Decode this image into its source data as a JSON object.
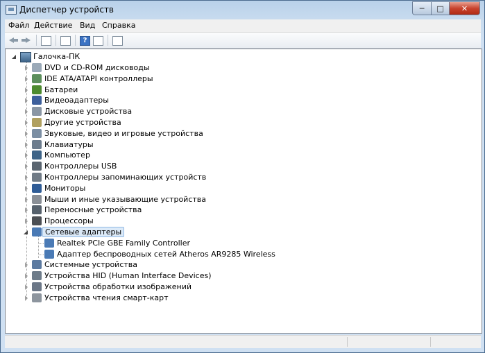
{
  "window": {
    "title": "Диспетчер устройств"
  },
  "menu": [
    {
      "label": "Файл"
    },
    {
      "label": "Действие"
    },
    {
      "label": "Вид"
    },
    {
      "label": "Справка"
    }
  ],
  "tree": {
    "root": "Галочка-ПК",
    "categories": [
      {
        "label": "DVD и CD-ROM дисководы",
        "icon": "dvd-drive-icon"
      },
      {
        "label": "IDE ATA/ATAPI контроллеры",
        "icon": "ide-controller-icon"
      },
      {
        "label": "Батареи",
        "icon": "battery-icon"
      },
      {
        "label": "Видеоадаптеры",
        "icon": "display-adapter-icon"
      },
      {
        "label": "Дисковые устройства",
        "icon": "disk-drive-icon"
      },
      {
        "label": "Другие устройства",
        "icon": "other-devices-icon"
      },
      {
        "label": "Звуковые, видео и игровые устройства",
        "icon": "speaker-icon"
      },
      {
        "label": "Клавиатуры",
        "icon": "keyboard-icon"
      },
      {
        "label": "Компьютер",
        "icon": "computer-icon"
      },
      {
        "label": "Контроллеры USB",
        "icon": "usb-icon"
      },
      {
        "label": "Контроллеры запоминающих устройств",
        "icon": "storage-controller-icon"
      },
      {
        "label": "Мониторы",
        "icon": "monitor-icon"
      },
      {
        "label": "Мыши и иные указывающие устройства",
        "icon": "mouse-icon"
      },
      {
        "label": "Переносные устройства",
        "icon": "portable-device-icon"
      },
      {
        "label": "Процессоры",
        "icon": "processor-icon"
      },
      {
        "label": "Сетевые адаптеры",
        "icon": "network-adapter-icon",
        "expanded": true,
        "selected": true
      },
      {
        "label": "Системные устройства",
        "icon": "system-devices-icon"
      },
      {
        "label": "Устройства HID (Human Interface Devices)",
        "icon": "hid-icon"
      },
      {
        "label": "Устройства обработки изображений",
        "icon": "imaging-device-icon"
      },
      {
        "label": "Устройства чтения смарт-карт",
        "icon": "smart-card-reader-icon"
      }
    ],
    "network_children": [
      {
        "label": "Realtek PCIe GBE Family Controller"
      },
      {
        "label": "Адаптер беспроводных сетей Atheros AR9285 Wireless"
      }
    ]
  }
}
